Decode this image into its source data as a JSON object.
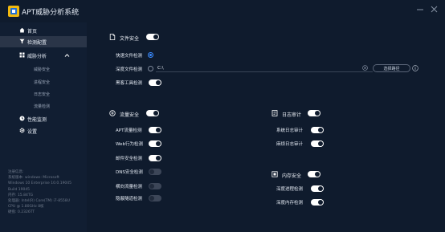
{
  "window": {
    "title": "APT威胁分析系统",
    "logo_icon": "app-logo-icon",
    "controls": [
      "minimize-icon",
      "close-icon"
    ]
  },
  "sidebar": {
    "items": [
      {
        "label": "首页",
        "icon": "home-icon"
      },
      {
        "label": "检测配置",
        "icon": "filter-icon",
        "active": true
      },
      {
        "label": "威胁分析",
        "icon": "grid-icon",
        "expanded": true,
        "children": [
          "威胁安全",
          "进程安全",
          "日志安全",
          "流量检测"
        ]
      },
      {
        "label": "性能监测",
        "icon": "monitor-icon"
      },
      {
        "label": "设置",
        "icon": "gear-icon"
      }
    ],
    "system_info": [
      "注册信息:",
      "系统版本: windows: Microsoft",
      "Windows 10 Enterprise 10.0.19045",
      "Build 19045",
      "内存: 15.84TG",
      "处理器: Intel(R) Core(TM) i7-8558U",
      "CPU @ 1.80GHz 8核",
      "硬盘: 0.2326TT"
    ]
  },
  "file_security": {
    "title": "文件安全",
    "enabled": true,
    "quick_scan": {
      "label": "快速文件检测",
      "selected": true
    },
    "deep_scan": {
      "label": "深度文件检测",
      "selected": false,
      "path": "C:\\",
      "browse_label": "选择路径"
    },
    "hacker_tool": {
      "label": "黑客工具检测",
      "enabled": true
    }
  },
  "traffic_security": {
    "title": "流量安全",
    "enabled": true,
    "items": [
      {
        "label": "APT流量检测",
        "enabled": true
      },
      {
        "label": "Web行为检测",
        "enabled": true
      },
      {
        "label": "邮件安全检测",
        "enabled": true
      },
      {
        "label": "DNS安全检测",
        "enabled": false
      },
      {
        "label": "横向流量检测",
        "enabled": false
      },
      {
        "label": "隐蔽隧道检测",
        "enabled": false
      }
    ]
  },
  "log_audit": {
    "title": "日志审计",
    "enabled": true,
    "items": [
      {
        "label": "系统日志审计",
        "enabled": true
      },
      {
        "label": "麻烦日志审计",
        "enabled": true
      }
    ]
  },
  "memory_security": {
    "title": "内存安全",
    "enabled": true,
    "items": [
      {
        "label": "深度进程检测",
        "enabled": true
      },
      {
        "label": "深度内存检测",
        "enabled": true
      }
    ]
  },
  "colors": {
    "background": "#0f1b2d",
    "sidebar": "#111e32",
    "active_nav": "#2a3548",
    "accent": "#3a8bff",
    "toggle_on": "#ffffff",
    "toggle_off": "#3c4658"
  }
}
